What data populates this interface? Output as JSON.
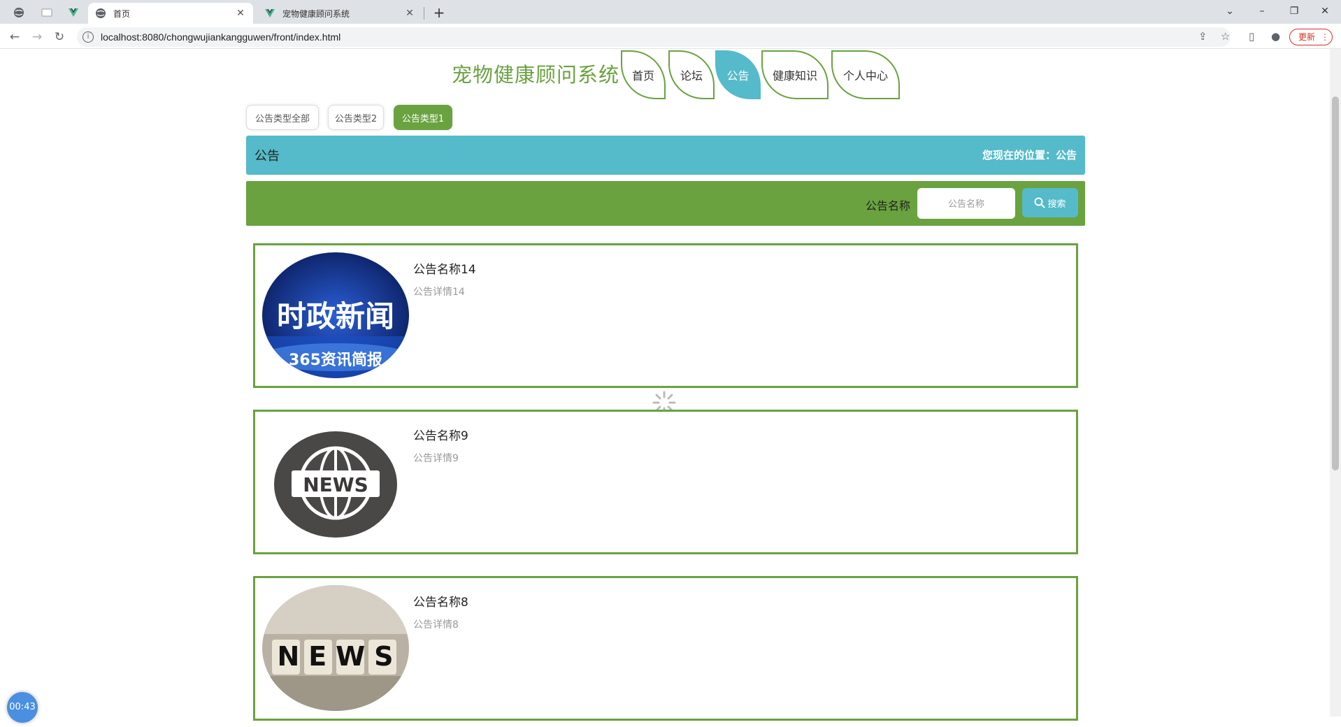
{
  "browser": {
    "tabs": [
      {
        "title": "首页",
        "active": true
      },
      {
        "title": "宠物健康顾问系统",
        "active": false
      }
    ],
    "url": "localhost:8080/chongwujiankangguwen/front/index.html",
    "update_label": "更新",
    "new_tab_label": "+"
  },
  "site": {
    "title": "宠物健康顾问系统",
    "nav": [
      {
        "label": "首页",
        "active": false
      },
      {
        "label": "论坛",
        "active": false
      },
      {
        "label": "公告",
        "active": true
      },
      {
        "label": "健康知识",
        "active": false
      },
      {
        "label": "个人中心",
        "active": false
      }
    ]
  },
  "types": [
    {
      "label": "公告类型全部",
      "active": false
    },
    {
      "label": "公告类型2",
      "active": false
    },
    {
      "label": "公告类型1",
      "active": true
    }
  ],
  "crumb": {
    "title": "公告",
    "location": "您现在的位置：公告"
  },
  "search": {
    "label": "公告名称",
    "placeholder": "公告名称",
    "button": "搜索"
  },
  "announcements": [
    {
      "title": "公告名称14",
      "detail": "公告详情14",
      "image_icon": "news-banner-image",
      "image_text": "时政新闻",
      "image_subtext": "365资讯简报"
    },
    {
      "title": "公告名称9",
      "detail": "公告详情9",
      "image_icon": "globe-news-image",
      "image_text": "NEWS"
    },
    {
      "title": "公告名称8",
      "detail": "公告详情8",
      "image_icon": "news-blocks-image",
      "image_text": "NEWS"
    }
  ],
  "timer": "00:43",
  "colors": {
    "green": "#6aa23f",
    "teal": "#55bac9"
  }
}
